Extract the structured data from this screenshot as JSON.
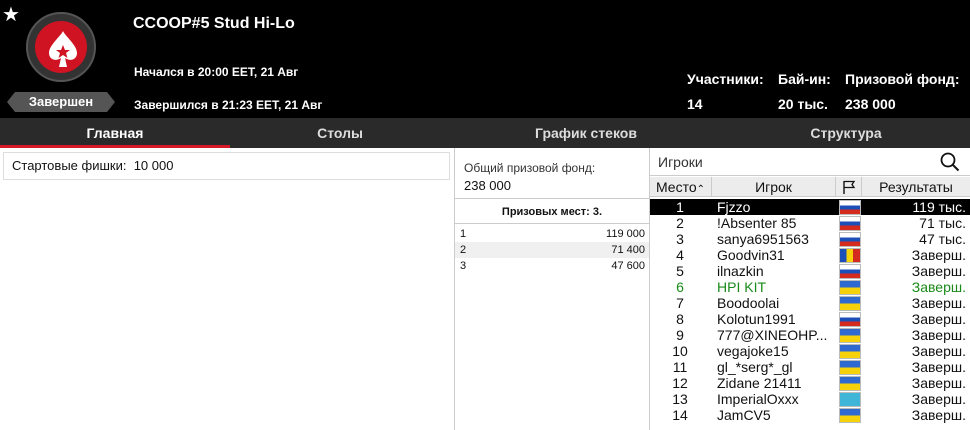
{
  "header": {
    "title": "CCOOP#5 Stud Hi-Lo",
    "started": "Начался в 20:00 EET, 21 Авг",
    "ended": "Завершился в 21:23 EET, 21 Авг",
    "status": "Завершен",
    "stats": [
      {
        "label": "Участники:",
        "value": "14"
      },
      {
        "label": "Бай-ин:",
        "value": "20 тыс."
      },
      {
        "label": "Призовой фонд:",
        "value": "238 000"
      }
    ]
  },
  "tabs": [
    {
      "label": "Главная",
      "active": true
    },
    {
      "label": "Столы",
      "active": false
    },
    {
      "label": "График стеков",
      "active": false
    },
    {
      "label": "Структура",
      "active": false
    }
  ],
  "main": {
    "starting_chips_label": "Стартовые фишки:",
    "starting_chips_value": "10 000"
  },
  "prizes": {
    "pool_label": "Общий призовой фонд:",
    "pool_value": "238 000",
    "places_header": "Призовых мест: 3.",
    "rows": [
      {
        "place": "1",
        "amount": "119 000"
      },
      {
        "place": "2",
        "amount": "71 400"
      },
      {
        "place": "3",
        "amount": "47 600"
      }
    ]
  },
  "players": {
    "search_label": "Игроки",
    "columns": {
      "place": "Место",
      "player": "Игрок",
      "results": "Результаты"
    },
    "rows": [
      {
        "place": "1",
        "name": "Fjzzo",
        "flag": "ru",
        "result": "119 тыс."
      },
      {
        "place": "2",
        "name": "!Absenter 85",
        "flag": "ru",
        "result": "71 тыс."
      },
      {
        "place": "3",
        "name": "sanya6951563",
        "flag": "ru",
        "result": "47 тыс."
      },
      {
        "place": "4",
        "name": "Goodvin31",
        "flag": "md",
        "result": "Заверш."
      },
      {
        "place": "5",
        "name": "ilnazkin",
        "flag": "ru",
        "result": "Заверш."
      },
      {
        "place": "6",
        "name": "HPI KIT",
        "flag": "ua",
        "result": "Заверш."
      },
      {
        "place": "7",
        "name": "Boodoolai",
        "flag": "ua",
        "result": "Заверш."
      },
      {
        "place": "8",
        "name": "Kolotun1991",
        "flag": "ru",
        "result": "Заверш."
      },
      {
        "place": "9",
        "name": "777@XINEOHP...",
        "flag": "ua",
        "result": "Заверш."
      },
      {
        "place": "10",
        "name": "vegajoke15",
        "flag": "ua",
        "result": "Заверш."
      },
      {
        "place": "11",
        "name": "gl_*serg*_gl",
        "flag": "ua",
        "result": "Заверш."
      },
      {
        "place": "12",
        "name": "Zidane 21411",
        "flag": "ua",
        "result": "Заверш."
      },
      {
        "place": "13",
        "name": "ImperialOxxx",
        "flag": "kz",
        "result": "Заверш."
      },
      {
        "place": "14",
        "name": "JamCV5",
        "flag": "ua",
        "result": "Заверш."
      }
    ]
  },
  "colors": {
    "accent": "#d7182a",
    "header_bg": "#000000",
    "tab_bg": "#2a2a2a",
    "winner_green": "#1a8a1a"
  },
  "icons": {
    "favorite": "star-icon",
    "logo": "pokerstars-spade-logo",
    "search": "search-icon",
    "sort": "chevron-up-icon",
    "flag_column": "flag-icon"
  }
}
